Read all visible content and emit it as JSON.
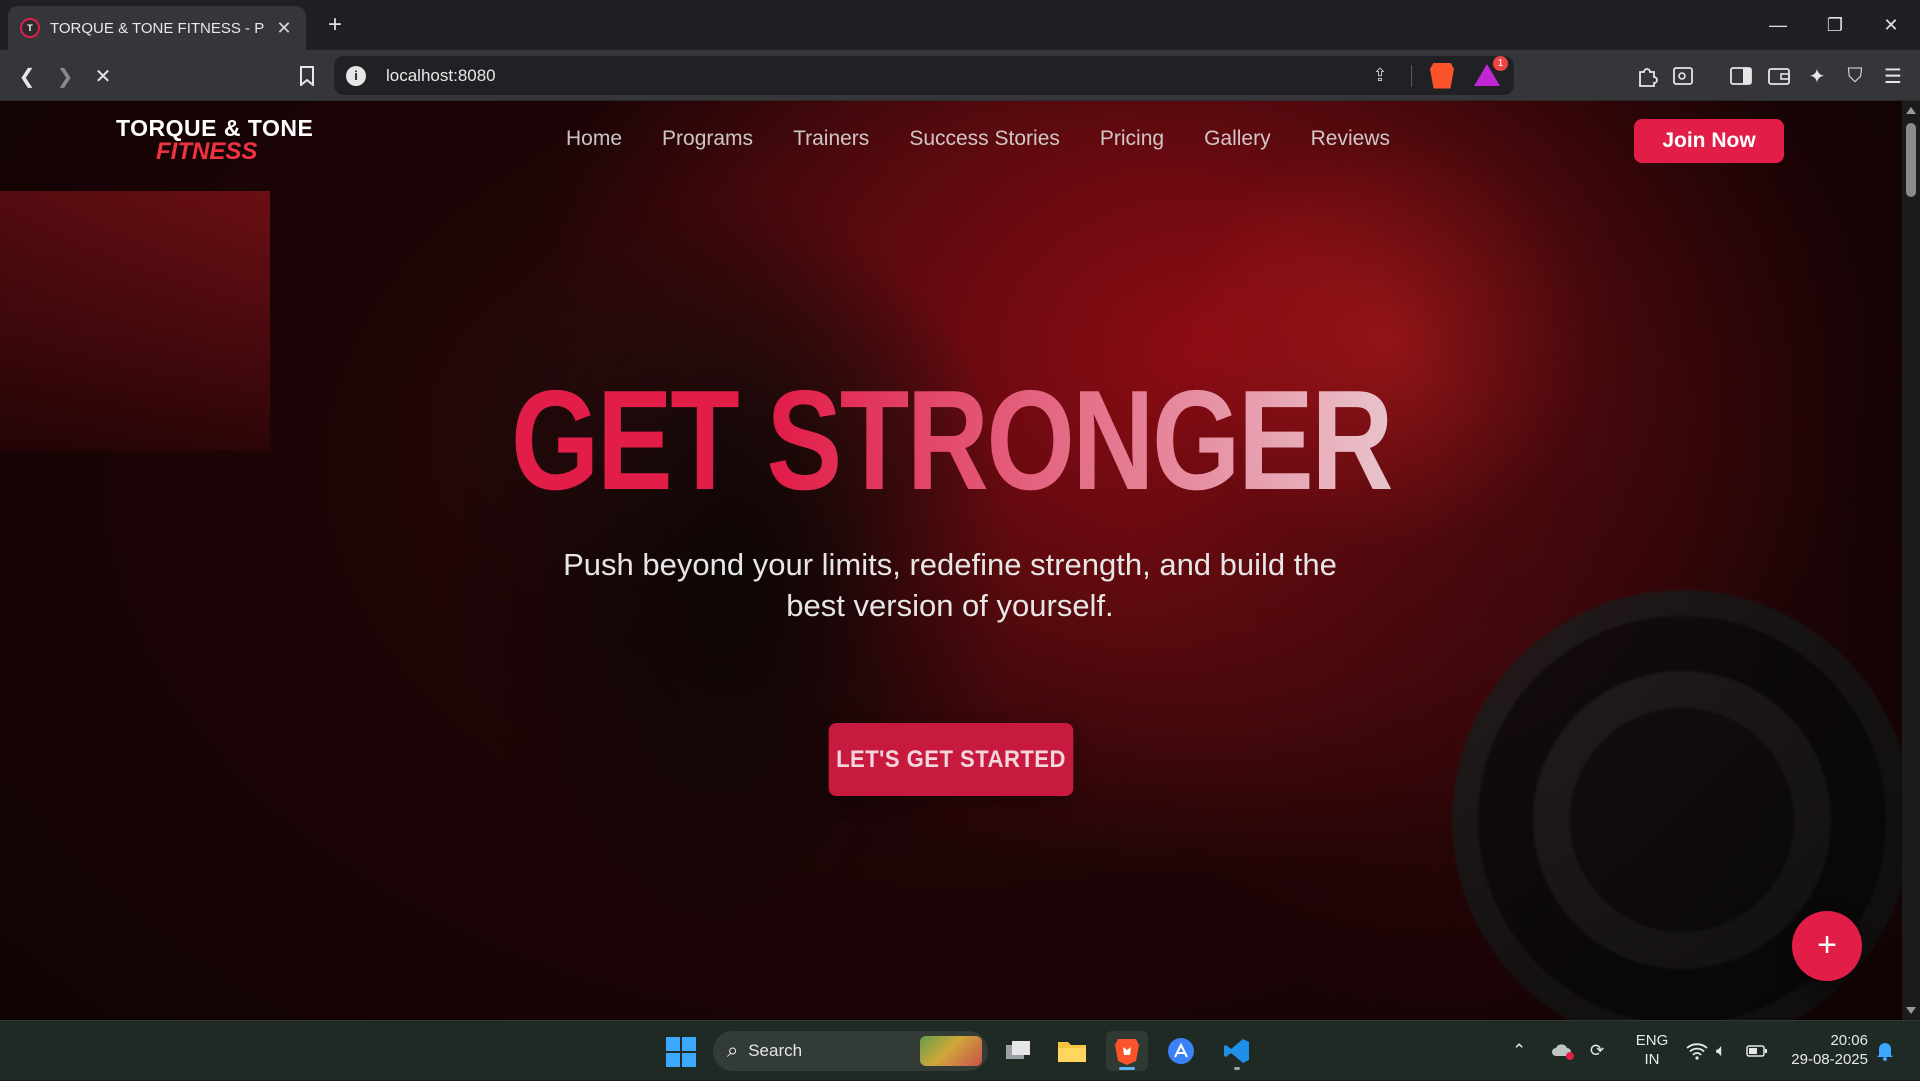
{
  "browser": {
    "tab": {
      "title": "TORQUE & TONE FITNESS - Premium Fitness"
    },
    "address": {
      "url": "localhost:8080"
    },
    "rewards_badge": "1"
  },
  "site": {
    "logo": {
      "line1": "TORQUE & TONE",
      "line2": "FITNESS"
    },
    "nav": [
      "Home",
      "Programs",
      "Trainers",
      "Success Stories",
      "Pricing",
      "Gallery",
      "Reviews"
    ],
    "join_label": "Join Now",
    "hero": {
      "title": "GET STRONGER",
      "subtitle": "Push beyond your limits, redefine strength, and build the best version of yourself.",
      "cta": "LET'S GET STARTED"
    },
    "fab_label": "+"
  },
  "taskbar": {
    "search_label": "Search",
    "lang_line1": "ENG",
    "lang_line2": "IN",
    "time": "20:06",
    "date": "29-08-2025"
  },
  "colors": {
    "accent": "#e11d48",
    "brand_red": "#ef3340"
  }
}
